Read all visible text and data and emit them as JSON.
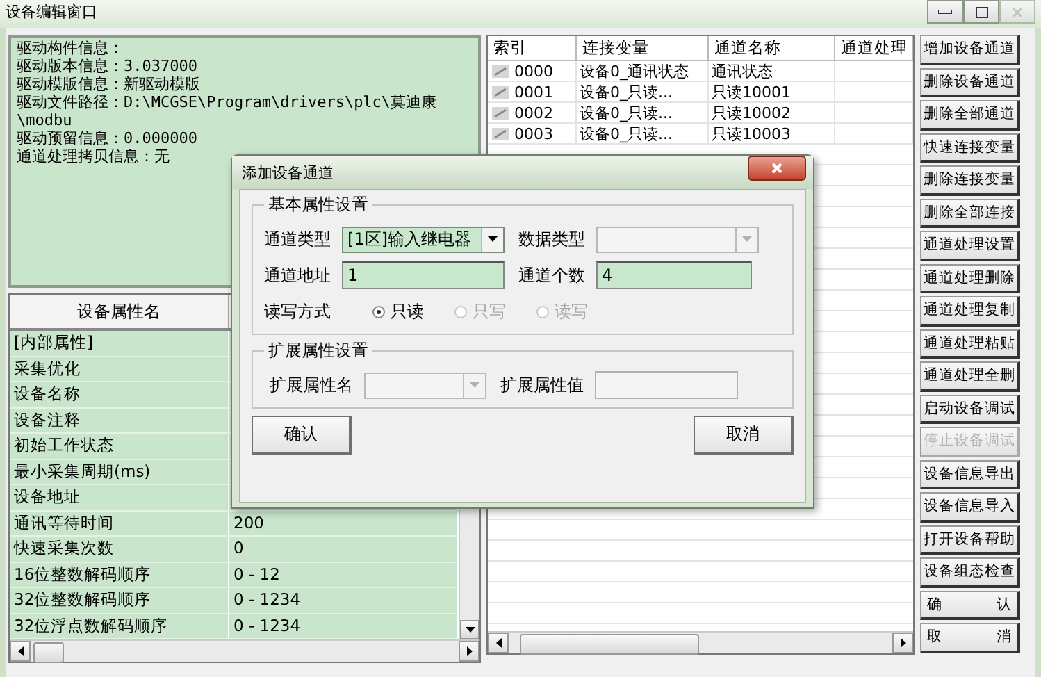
{
  "window": {
    "title": "设备编辑窗口"
  },
  "driver_info": [
    "驱动构件信息：",
    "驱动版本信息：3.037000",
    "驱动模版信息：新驱动模版",
    "驱动文件路径：D:\\MCGSE\\Program\\drivers\\plc\\莫迪康\\modbu",
    "驱动预留信息：0.000000",
    "通道处理拷贝信息：无"
  ],
  "properties": {
    "columns": [
      "设备属性名"
    ],
    "rows": [
      {
        "name": "[内部属性]"
      },
      {
        "name": "采集优化"
      },
      {
        "name": "设备名称"
      },
      {
        "name": "设备注释"
      },
      {
        "name": "初始工作状态"
      },
      {
        "name": "最小采集周期(ms)"
      },
      {
        "name": "设备地址"
      },
      {
        "name": "通讯等待时间",
        "value": "200"
      },
      {
        "name": "快速采集次数",
        "value": "0"
      },
      {
        "name": "16位整数解码顺序",
        "value": "0 - 12"
      },
      {
        "name": "32位整数解码顺序",
        "value": "0 - 1234"
      },
      {
        "name": "32位浮点数解码顺序",
        "value": "0 - 1234"
      }
    ]
  },
  "channels": {
    "columns": [
      "索引",
      "连接变量",
      "通道名称",
      "通道处理"
    ],
    "rows": [
      {
        "index": "0000",
        "variable": "设备0_通讯状态",
        "name": "通讯状态"
      },
      {
        "index": "0001",
        "variable": "设备0_只读...",
        "name": "只读10001"
      },
      {
        "index": "0002",
        "variable": "设备0_只读...",
        "name": "只读10002"
      },
      {
        "index": "0003",
        "variable": "设备0_只读...",
        "name": "只读10003"
      }
    ]
  },
  "buttons": [
    {
      "label": "增加设备通道",
      "disabled": false
    },
    {
      "label": "删除设备通道",
      "disabled": false
    },
    {
      "label": "删除全部通道",
      "disabled": false
    },
    {
      "label": "快速连接变量",
      "disabled": false
    },
    {
      "label": "删除连接变量",
      "disabled": false
    },
    {
      "label": "删除全部连接",
      "disabled": false
    },
    {
      "label": "通道处理设置",
      "disabled": false
    },
    {
      "label": "通道处理删除",
      "disabled": false
    },
    {
      "label": "通道处理复制",
      "disabled": false
    },
    {
      "label": "通道处理粘贴",
      "disabled": false
    },
    {
      "label": "通道处理全删",
      "disabled": false
    },
    {
      "label": "启动设备调试",
      "disabled": false
    },
    {
      "label": "停止设备调试",
      "disabled": true
    },
    {
      "label": "设备信息导出",
      "disabled": false
    },
    {
      "label": "设备信息导入",
      "disabled": false
    },
    {
      "label": "打开设备帮助",
      "disabled": false
    },
    {
      "label": "设备组态检查",
      "disabled": false
    },
    {
      "label": "确 认",
      "disabled": false
    },
    {
      "label": "取 消",
      "disabled": false
    }
  ],
  "dialog": {
    "title": "添加设备通道",
    "basic_group": {
      "title": "基本属性设置",
      "channel_type": {
        "label": "通道类型",
        "value": "[1区]输入继电器",
        "disabled": false
      },
      "data_type": {
        "label": "数据类型",
        "disabled": true
      },
      "channel_address": {
        "label": "通道地址",
        "value": "1"
      },
      "channel_count": {
        "label": "通道个数",
        "value": "4"
      },
      "access_mode": {
        "label": "读写方式",
        "options": [
          {
            "label": "只读",
            "selected": true,
            "disabled": false
          },
          {
            "label": "只写",
            "selected": false,
            "disabled": true
          },
          {
            "label": "读写",
            "selected": false,
            "disabled": true
          }
        ]
      }
    },
    "ext_group": {
      "title": "扩展属性设置",
      "ext_name": {
        "label": "扩展属性名",
        "disabled": true
      },
      "ext_value": {
        "label": "扩展属性值",
        "disabled": true
      }
    },
    "buttons": [
      "确认",
      "取消"
    ]
  }
}
